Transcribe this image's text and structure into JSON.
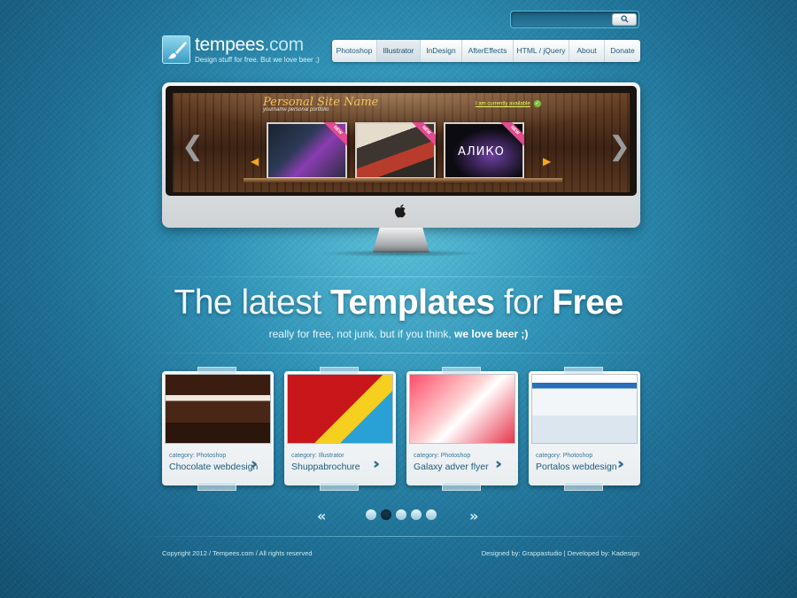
{
  "search": {
    "placeholder": "",
    "button_icon": "search-icon"
  },
  "logo": {
    "name": "tempees",
    "tld": ".com",
    "tagline": "Design stuff for free. But we love beer ;)"
  },
  "nav": {
    "items": [
      {
        "label": "Photoshop"
      },
      {
        "label": "Illustrator",
        "active": true
      },
      {
        "label": "InDesign"
      },
      {
        "label": "AfterEffects"
      },
      {
        "label": "HTML / jQuery"
      },
      {
        "label": "About"
      },
      {
        "label": "Donate"
      }
    ]
  },
  "slider": {
    "site_title": "Personal Site Name",
    "site_subtitle": "yourname personal portfolio",
    "availability": "I am currently available",
    "thumbs": [
      {
        "badge": "NEW"
      },
      {
        "badge": "NEW"
      },
      {
        "label": "АЛИКО",
        "badge": "NEW"
      }
    ],
    "prev_icon": "chevron-left-icon",
    "next_icon": "chevron-right-icon"
  },
  "headline": {
    "part1": "The latest ",
    "part2": "Templates",
    "part3": " for ",
    "part4": "Free",
    "sub_prefix": "really for free, not junk, but if you think, ",
    "sub_bold": "we love beer ;)"
  },
  "cards": [
    {
      "category": "category: Photoshop",
      "title": "Chocolate webdesign"
    },
    {
      "category": "category: Illustrator",
      "title": "Shuppabrochure"
    },
    {
      "category": "category: Photoshop",
      "title": "Galaxy adver flyer"
    },
    {
      "category": "category: Photoshop",
      "title": "Portalos webdesign"
    }
  ],
  "pager": {
    "prev": "«",
    "next": "»",
    "pages": 5,
    "current": 2
  },
  "footer": {
    "copyright": "Copyright 2012 / Tempees.com / All rights reserved",
    "credits": "Designed by: Grappastudio  |  Developed by: Kadesign"
  },
  "colors": {
    "accent": "#1f5a78",
    "background": "#2f93b8",
    "ribbon": "#e14b8f"
  }
}
